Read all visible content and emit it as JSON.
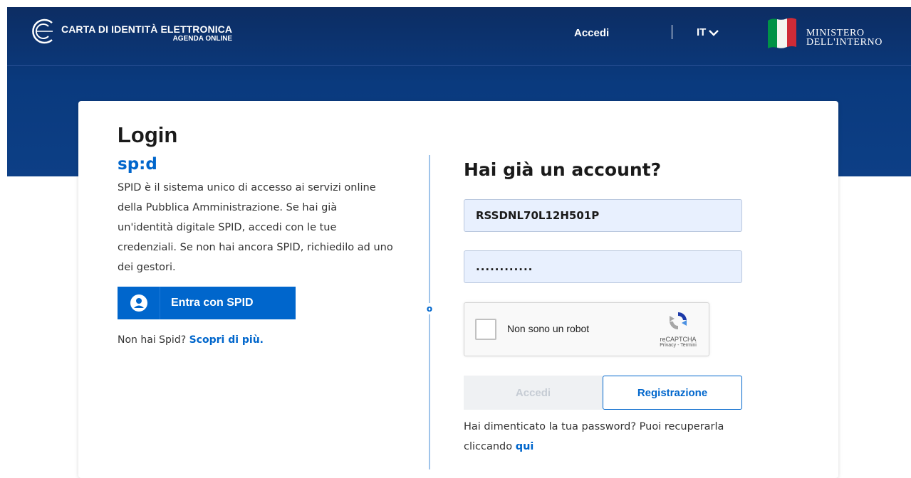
{
  "header": {
    "brand_title": "CARTA DI IDENTITÀ ELETTRONICA",
    "brand_subtitle": "AGENDA ONLINE",
    "nav_login": "Accedi",
    "language": "IT",
    "ministry_line1": "MINISTERO",
    "ministry_line2": "DELL'INTERNO"
  },
  "left": {
    "title": "Login",
    "spid_logo": "sp:d",
    "description": "SPID è il sistema unico di accesso ai servizi online della Pubblica Amministrazione. Se hai già un'identità digitale SPID, accedi con le tue credenziali. Se non hai ancora SPID, richiedilo ad uno dei gestori.",
    "spid_button": "Entra con SPID",
    "no_spid_text": "Non hai Spid?",
    "no_spid_link": "Scopri di più."
  },
  "divider_label": "o",
  "right": {
    "title": "Hai già un account?",
    "username_value": "RSSDNL70L12H501P",
    "password_value": "............",
    "captcha_label": "Non sono un robot",
    "captcha_brand": "reCAPTCHA",
    "captcha_links": "Privacy - Termini",
    "login_button": "Accedi",
    "register_button": "Registrazione",
    "forgot_text": "Hai dimenticato la tua password? Puoi recuperarla cliccando",
    "forgot_link": "qui"
  },
  "colors": {
    "header_bg": "#0d3f86",
    "accent": "#0066cc",
    "field_bg": "#e8f0fe"
  }
}
